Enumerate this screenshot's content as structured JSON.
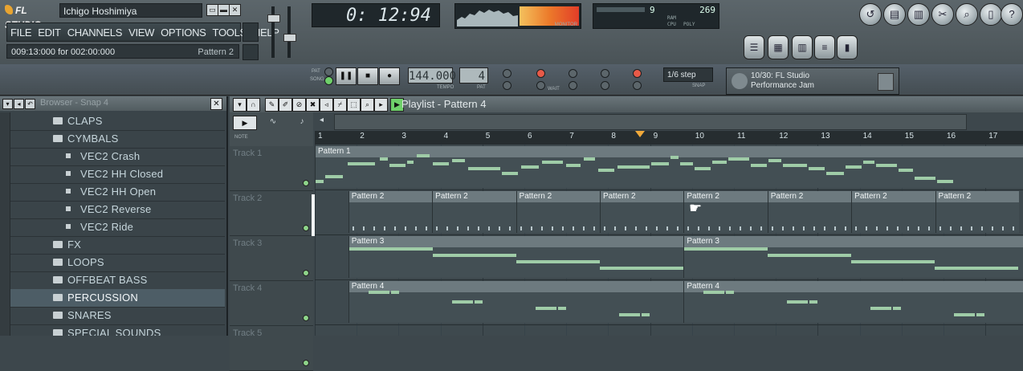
{
  "app": {
    "logo": "FL STUDIO",
    "song_name": "Ichigo Hoshimiya",
    "menu": [
      "FILE",
      "EDIT",
      "CHANNELS",
      "VIEW",
      "OPTIONS",
      "TOOLS",
      "HELP"
    ],
    "hint_text": "009:13:000 for 002:00:000",
    "hint_pattern": "Pattern 2"
  },
  "time_display": "0: 12:94",
  "monitor_label": "MONITOR",
  "cpu": {
    "value1": "9",
    "value2": "269",
    "ram_label": "RAM",
    "cpu_label": "CPU",
    "poly_label": "POLY"
  },
  "transport": {
    "pat_label": "PAT",
    "song_label": "SONG",
    "tempo": "144.000",
    "tempo_label": "TEMPO",
    "pattern_num": "4",
    "pattern_label": "PAT",
    "step": "1/6 step",
    "snap_label": "SNAP",
    "wait_label": "WAIT"
  },
  "news": {
    "line1": "10/30: FL Studio",
    "line2": "Performance Jam"
  },
  "browser": {
    "title": "Browser - Snap 4",
    "items": [
      {
        "label": "CLAPS",
        "indent": 1
      },
      {
        "label": "CYMBALS",
        "indent": 1
      },
      {
        "label": "VEC2 Crash",
        "indent": 2
      },
      {
        "label": "VEC2 HH Closed",
        "indent": 2
      },
      {
        "label": "VEC2 HH Open",
        "indent": 2
      },
      {
        "label": "VEC2 Reverse",
        "indent": 2
      },
      {
        "label": "VEC2 Ride",
        "indent": 2
      },
      {
        "label": "FX",
        "indent": 1
      },
      {
        "label": "LOOPS",
        "indent": 1
      },
      {
        "label": "OFFBEAT BASS",
        "indent": 1
      },
      {
        "label": "PERCUSSION",
        "indent": 1,
        "selected": true
      },
      {
        "label": "SNARES",
        "indent": 1
      },
      {
        "label": "SPECIAL SOUNDS",
        "indent": 1
      }
    ]
  },
  "playlist": {
    "title": "Playlist - Pattern 4",
    "side_labels": {
      "note": "NOTE"
    },
    "ruler": [
      "1",
      "2",
      "3",
      "4",
      "5",
      "6",
      "7",
      "8",
      "9",
      "10",
      "11",
      "12",
      "13",
      "14",
      "15",
      "16",
      "17"
    ],
    "tracks": [
      {
        "name": "Track 1",
        "clips": [
          {
            "label": "Pattern 1"
          }
        ]
      },
      {
        "name": "Track 2",
        "clips": [
          {
            "label": "Pattern 2"
          },
          {
            "label": "Pattern 2"
          },
          {
            "label": "Pattern 2"
          },
          {
            "label": "Pattern 2"
          },
          {
            "label": "Pattern 2"
          },
          {
            "label": "Pattern 2"
          },
          {
            "label": "Pattern 2"
          },
          {
            "label": "Pattern 2"
          }
        ]
      },
      {
        "name": "Track 3",
        "clips": [
          {
            "label": "Pattern 3"
          },
          {
            "label": "Pattern 3"
          }
        ]
      },
      {
        "name": "Track 4",
        "clips": [
          {
            "label": "Pattern 4"
          },
          {
            "label": "Pattern 4"
          }
        ]
      },
      {
        "name": "Track 5",
        "clips": []
      }
    ]
  },
  "colors": {
    "note": "#9fcca7",
    "clip_header": "#6d7a7f",
    "accent": "#e8a431"
  }
}
